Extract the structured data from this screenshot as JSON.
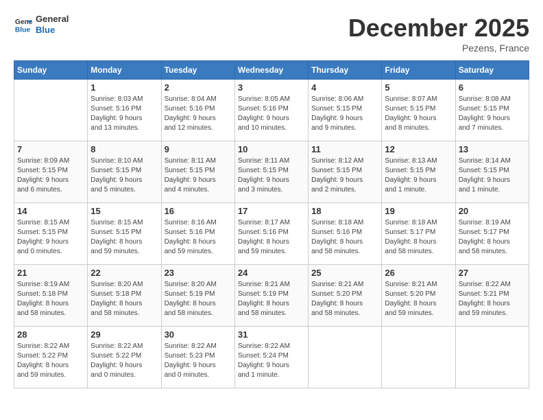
{
  "header": {
    "logo_line1": "General",
    "logo_line2": "Blue",
    "month_title": "December 2025",
    "location": "Pezens, France"
  },
  "days_of_week": [
    "Sunday",
    "Monday",
    "Tuesday",
    "Wednesday",
    "Thursday",
    "Friday",
    "Saturday"
  ],
  "weeks": [
    [
      {
        "day": "",
        "info": ""
      },
      {
        "day": "1",
        "info": "Sunrise: 8:03 AM\nSunset: 5:16 PM\nDaylight: 9 hours\nand 13 minutes."
      },
      {
        "day": "2",
        "info": "Sunrise: 8:04 AM\nSunset: 5:16 PM\nDaylight: 9 hours\nand 12 minutes."
      },
      {
        "day": "3",
        "info": "Sunrise: 8:05 AM\nSunset: 5:16 PM\nDaylight: 9 hours\nand 10 minutes."
      },
      {
        "day": "4",
        "info": "Sunrise: 8:06 AM\nSunset: 5:15 PM\nDaylight: 9 hours\nand 9 minutes."
      },
      {
        "day": "5",
        "info": "Sunrise: 8:07 AM\nSunset: 5:15 PM\nDaylight: 9 hours\nand 8 minutes."
      },
      {
        "day": "6",
        "info": "Sunrise: 8:08 AM\nSunset: 5:15 PM\nDaylight: 9 hours\nand 7 minutes."
      }
    ],
    [
      {
        "day": "7",
        "info": "Sunrise: 8:09 AM\nSunset: 5:15 PM\nDaylight: 9 hours\nand 6 minutes."
      },
      {
        "day": "8",
        "info": "Sunrise: 8:10 AM\nSunset: 5:15 PM\nDaylight: 9 hours\nand 5 minutes."
      },
      {
        "day": "9",
        "info": "Sunrise: 8:11 AM\nSunset: 5:15 PM\nDaylight: 9 hours\nand 4 minutes."
      },
      {
        "day": "10",
        "info": "Sunrise: 8:11 AM\nSunset: 5:15 PM\nDaylight: 9 hours\nand 3 minutes."
      },
      {
        "day": "11",
        "info": "Sunrise: 8:12 AM\nSunset: 5:15 PM\nDaylight: 9 hours\nand 2 minutes."
      },
      {
        "day": "12",
        "info": "Sunrise: 8:13 AM\nSunset: 5:15 PM\nDaylight: 9 hours\nand 1 minute."
      },
      {
        "day": "13",
        "info": "Sunrise: 8:14 AM\nSunset: 5:15 PM\nDaylight: 9 hours\nand 1 minute."
      }
    ],
    [
      {
        "day": "14",
        "info": "Sunrise: 8:15 AM\nSunset: 5:15 PM\nDaylight: 9 hours\nand 0 minutes."
      },
      {
        "day": "15",
        "info": "Sunrise: 8:15 AM\nSunset: 5:15 PM\nDaylight: 8 hours\nand 59 minutes."
      },
      {
        "day": "16",
        "info": "Sunrise: 8:16 AM\nSunset: 5:16 PM\nDaylight: 8 hours\nand 59 minutes."
      },
      {
        "day": "17",
        "info": "Sunrise: 8:17 AM\nSunset: 5:16 PM\nDaylight: 8 hours\nand 59 minutes."
      },
      {
        "day": "18",
        "info": "Sunrise: 8:18 AM\nSunset: 5:16 PM\nDaylight: 8 hours\nand 58 minutes."
      },
      {
        "day": "19",
        "info": "Sunrise: 8:18 AM\nSunset: 5:17 PM\nDaylight: 8 hours\nand 58 minutes."
      },
      {
        "day": "20",
        "info": "Sunrise: 8:19 AM\nSunset: 5:17 PM\nDaylight: 8 hours\nand 58 minutes."
      }
    ],
    [
      {
        "day": "21",
        "info": "Sunrise: 8:19 AM\nSunset: 5:18 PM\nDaylight: 8 hours\nand 58 minutes."
      },
      {
        "day": "22",
        "info": "Sunrise: 8:20 AM\nSunset: 5:18 PM\nDaylight: 8 hours\nand 58 minutes."
      },
      {
        "day": "23",
        "info": "Sunrise: 8:20 AM\nSunset: 5:19 PM\nDaylight: 8 hours\nand 58 minutes."
      },
      {
        "day": "24",
        "info": "Sunrise: 8:21 AM\nSunset: 5:19 PM\nDaylight: 8 hours\nand 58 minutes."
      },
      {
        "day": "25",
        "info": "Sunrise: 8:21 AM\nSunset: 5:20 PM\nDaylight: 8 hours\nand 58 minutes."
      },
      {
        "day": "26",
        "info": "Sunrise: 8:21 AM\nSunset: 5:20 PM\nDaylight: 8 hours\nand 59 minutes."
      },
      {
        "day": "27",
        "info": "Sunrise: 8:22 AM\nSunset: 5:21 PM\nDaylight: 8 hours\nand 59 minutes."
      }
    ],
    [
      {
        "day": "28",
        "info": "Sunrise: 8:22 AM\nSunset: 5:22 PM\nDaylight: 8 hours\nand 59 minutes."
      },
      {
        "day": "29",
        "info": "Sunrise: 8:22 AM\nSunset: 5:22 PM\nDaylight: 9 hours\nand 0 minutes."
      },
      {
        "day": "30",
        "info": "Sunrise: 8:22 AM\nSunset: 5:23 PM\nDaylight: 9 hours\nand 0 minutes."
      },
      {
        "day": "31",
        "info": "Sunrise: 8:22 AM\nSunset: 5:24 PM\nDaylight: 9 hours\nand 1 minute."
      },
      {
        "day": "",
        "info": ""
      },
      {
        "day": "",
        "info": ""
      },
      {
        "day": "",
        "info": ""
      }
    ]
  ]
}
